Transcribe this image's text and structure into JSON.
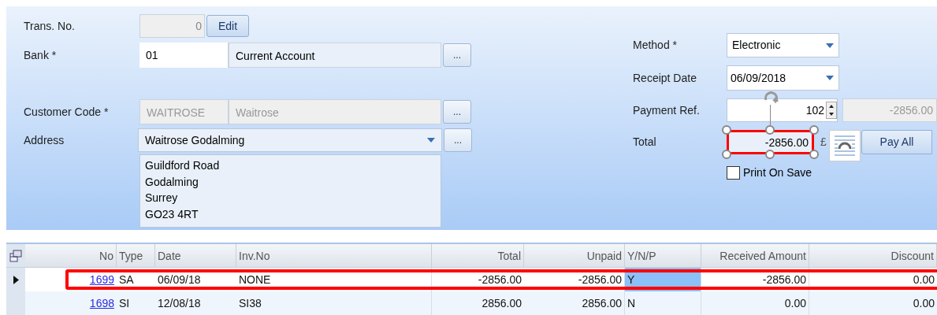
{
  "form": {
    "trans_no": {
      "label": "Trans. No.",
      "value": "0",
      "button": "Edit"
    },
    "bank": {
      "label": "Bank *",
      "code": "01",
      "name": "Current Account",
      "button": "..."
    },
    "customer": {
      "label": "Customer Code *",
      "code": "WAITROSE",
      "name": "Waitrose",
      "button": "..."
    },
    "address": {
      "label": "Address",
      "value": "Waitrose Godalming",
      "button": "...",
      "lines": [
        "Guildford Road",
        "Godalming",
        "Surrey",
        "GO23 4RT"
      ]
    },
    "method": {
      "label": "Method *",
      "value": "Electronic"
    },
    "receipt_date": {
      "label": "Receipt Date",
      "value": "06/09/2018"
    },
    "payment_ref": {
      "label": "Payment Ref.",
      "value": "102",
      "balance": "-2856.00"
    },
    "total": {
      "label": "Total",
      "value": "-2856.00",
      "highlighted": true,
      "currency": "£",
      "button": "Pay All"
    },
    "print_on_save": {
      "label": "Print On Save",
      "checked": false
    }
  },
  "table": {
    "columns": [
      "No",
      "Type",
      "Date",
      "Inv.No",
      "Total",
      "Unpaid",
      "Y/N/P",
      "Received Amount",
      "Discount"
    ],
    "rows": [
      {
        "selected": true,
        "highlighted": true,
        "yn_focused": true,
        "cells": [
          "1699",
          "SA",
          "06/09/18",
          "NONE",
          "-2856.00",
          "-2856.00",
          "Y",
          "-2856.00",
          "0.00"
        ]
      },
      {
        "selected": false,
        "highlighted": false,
        "yn_focused": false,
        "cells": [
          "1698",
          "SI",
          "12/08/18",
          "SI38",
          "2856.00",
          "2856.00",
          "N",
          "0.00",
          "0.00"
        ]
      }
    ]
  }
}
